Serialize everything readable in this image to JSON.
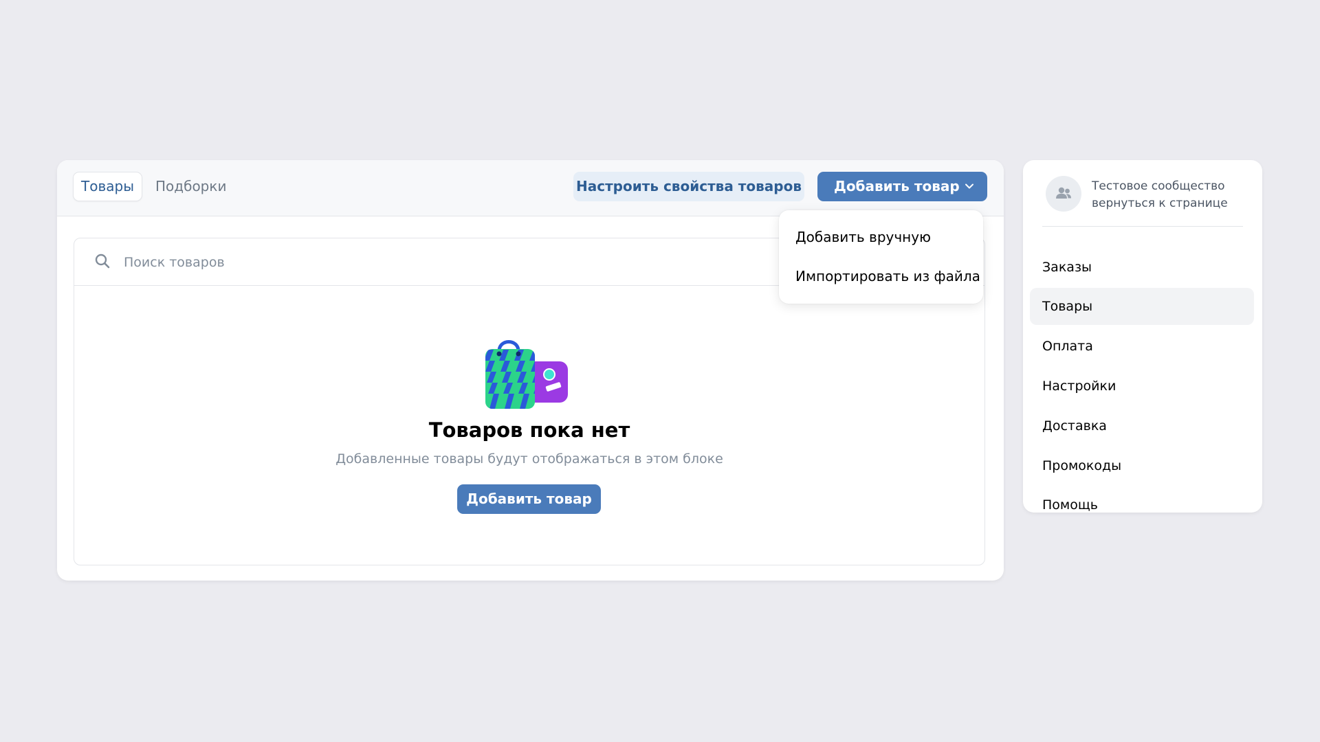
{
  "tabs": [
    {
      "label": "Товары",
      "active": true
    },
    {
      "label": "Подборки",
      "active": false
    }
  ],
  "toolbar": {
    "configure_label": "Настроить свойства товаров",
    "add_label": "Добавить товар"
  },
  "dropdown": {
    "items": [
      "Добавить вручную",
      "Импортировать из файла"
    ]
  },
  "search": {
    "placeholder": "Поиск товаров",
    "value": ""
  },
  "empty_state": {
    "title": "Товаров пока нет",
    "subtitle": "Добавленные товары будут отображаться в этом блоке",
    "button_label": "Добавить товар",
    "illustration": "shopping-bag-icon"
  },
  "sidebar": {
    "community_name": "Тестовое сообщество",
    "back_link": "вернуться к странице",
    "avatar_icon": "users-icon",
    "items": [
      {
        "label": "Заказы",
        "active": false
      },
      {
        "label": "Товары",
        "active": true
      },
      {
        "label": "Оплата",
        "active": false
      },
      {
        "label": "Настройки",
        "active": false
      },
      {
        "label": "Доставка",
        "active": false
      },
      {
        "label": "Промокоды",
        "active": false
      },
      {
        "label": "Помощь",
        "active": false
      }
    ]
  },
  "colors": {
    "background": "#ebebf0",
    "accent": "#4a7bba",
    "accent_text": "#2d5d93",
    "secondary_button": "#e6eef7",
    "muted_text": "#818c99"
  }
}
